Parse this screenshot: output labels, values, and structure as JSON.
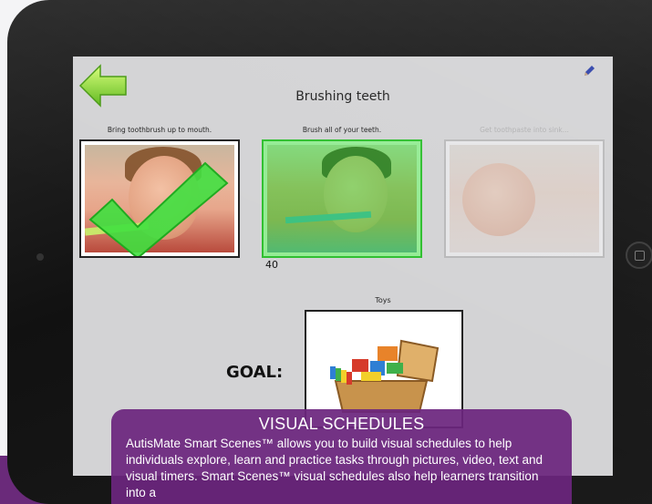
{
  "app": {
    "screen_title": "Brushing teeth",
    "steps": [
      {
        "label": "Bring toothbrush up to mouth.",
        "state": "completed",
        "icon": "checkmark-icon"
      },
      {
        "label": "Brush all of your teeth.",
        "state": "active",
        "timer": "40"
      },
      {
        "label": "Get toothpaste into sink...",
        "state": "upcoming"
      }
    ],
    "goal": {
      "label": "GOAL:",
      "title": "Toys",
      "image": "toy-box-icon"
    },
    "icons": {
      "back": "back-arrow-icon",
      "edit": "pencil-icon"
    },
    "colors": {
      "accent_green": "#39d43a",
      "screen_bg": "#d3d3d5",
      "caption_purple": "#6c267e"
    }
  },
  "caption": {
    "title": "VISUAL SCHEDULES",
    "body": "AutisMate Smart Scenes™ allows you to build visual schedules to help individuals explore, learn and practice tasks through pictures, video, text and visual timers.  Smart Scenes™ visual schedules also help learners transition into a"
  }
}
